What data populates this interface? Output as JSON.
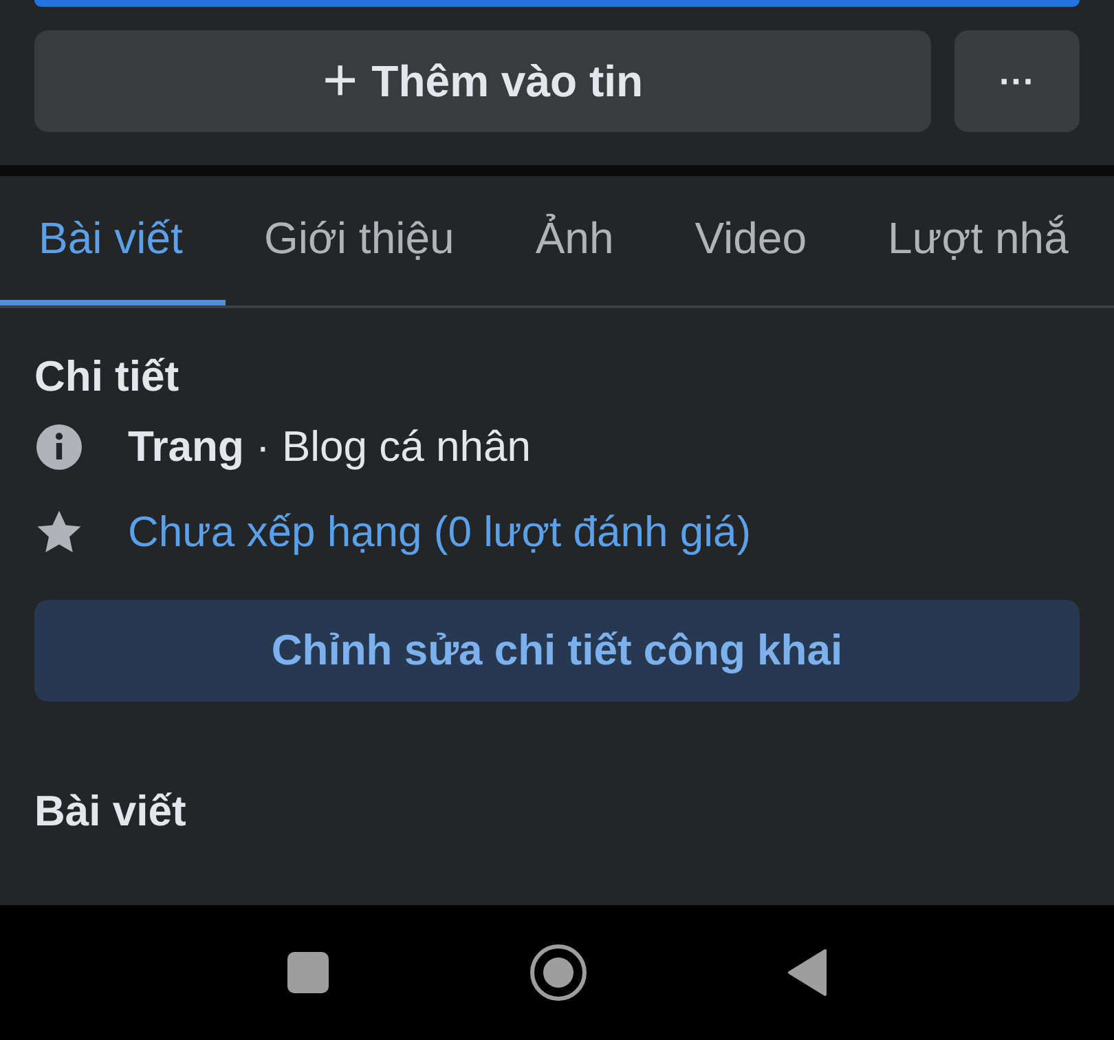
{
  "actions": {
    "add_button": {
      "icon": "+",
      "label": "Thêm vào tin"
    },
    "more_button": {
      "label": "···"
    }
  },
  "tabs": [
    {
      "label": "Bài viết",
      "selected": true
    },
    {
      "label": "Giới thiệu",
      "selected": false
    },
    {
      "label": "Ảnh",
      "selected": false
    },
    {
      "label": "Video",
      "selected": false
    },
    {
      "label": "Lượt nhắ",
      "selected": false
    }
  ],
  "details": {
    "title": "Chi tiết",
    "rows": [
      {
        "kind": "info",
        "text": "**Trang** · Blog cá nhân"
      },
      {
        "kind": "rating",
        "text": "Chưa xếp hạng (0 lượt đánh giá)"
      }
    ],
    "edit_button": "Chỉnh sửa chi tiết công khai"
  },
  "posts": {
    "title": "Bài viết"
  }
}
